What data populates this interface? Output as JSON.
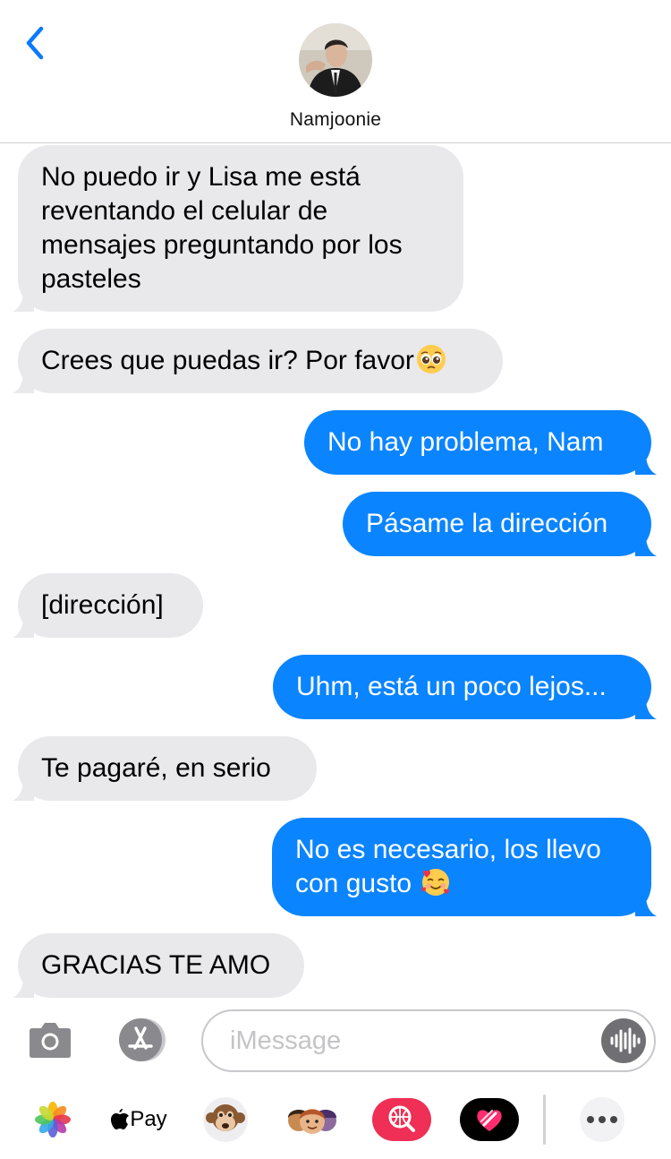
{
  "header": {
    "contact_name": "Namjoonie"
  },
  "messages": [
    {
      "direction": "incoming",
      "text": "No puedo ir y Lisa me está\nreventando el celular de\nmensajes preguntando por los\npasteles"
    },
    {
      "direction": "incoming",
      "text": "Crees que puedas ir? Por favor",
      "emoji": "pleading-face-emoji"
    },
    {
      "direction": "outgoing",
      "text": "No hay problema, Nam"
    },
    {
      "direction": "outgoing",
      "text": "Pásame la dirección"
    },
    {
      "direction": "incoming",
      "text": "[dirección]"
    },
    {
      "direction": "outgoing",
      "text": "Uhm, está un poco lejos..."
    },
    {
      "direction": "incoming",
      "text": "Te pagaré, en serio"
    },
    {
      "direction": "outgoing",
      "text": "No es necesario, los llevo\ncon gusto ",
      "emoji": "smiling-face-with-hearts-emoji"
    },
    {
      "direction": "incoming",
      "text": "GRACIAS TE AMO"
    }
  ],
  "composer": {
    "placeholder": "iMessage"
  },
  "app_drawer": {
    "apple_pay_label": "Pay",
    "icons": [
      "photos-icon",
      "apple-pay-icon",
      "animoji-monkey-icon",
      "memoji-stickers-icon",
      "web-search-icon",
      "digital-touch-icon",
      "more-icon"
    ]
  },
  "colors": {
    "incoming_bubble": "#e9e9eb",
    "outgoing_bubble": "#0b84ff",
    "accent": "#0a7aff"
  }
}
